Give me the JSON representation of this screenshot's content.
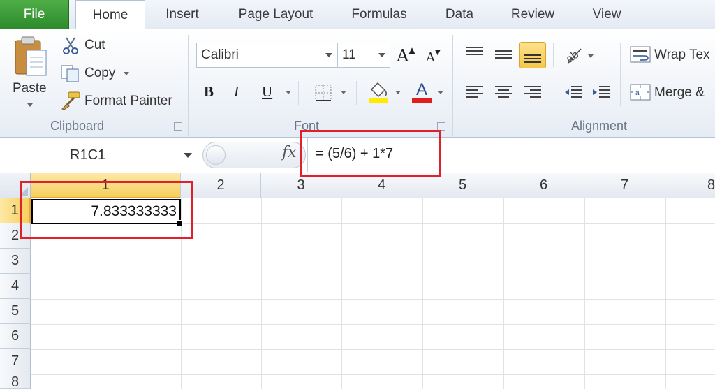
{
  "tabs": {
    "file": "File",
    "home": "Home",
    "insert": "Insert",
    "page_layout": "Page Layout",
    "formulas": "Formulas",
    "data": "Data",
    "review": "Review",
    "view": "View"
  },
  "clipboard": {
    "paste": "Paste",
    "cut": "Cut",
    "copy": "Copy",
    "format_painter": "Format Painter",
    "label": "Clipboard"
  },
  "font": {
    "name": "Calibri",
    "size": "11",
    "bold": "B",
    "italic": "I",
    "underline": "U",
    "label": "Font"
  },
  "alignment": {
    "wrap_text": "Wrap Tex",
    "merge": "Merge &",
    "label": "Alignment"
  },
  "formula_bar": {
    "name_box": "R1C1",
    "fx": "fx",
    "formula": "= (5/6) + 1*7"
  },
  "sheet": {
    "columns": [
      "1",
      "2",
      "3",
      "4",
      "5",
      "6",
      "7",
      "8"
    ],
    "rows": [
      "1",
      "2",
      "3",
      "4",
      "5",
      "6",
      "7",
      "8"
    ],
    "active_value": "7.833333333"
  },
  "colors": {
    "file_tab": "#3a9a36",
    "highlight": "#e0202a",
    "selected_header": "#f6cf5c"
  }
}
